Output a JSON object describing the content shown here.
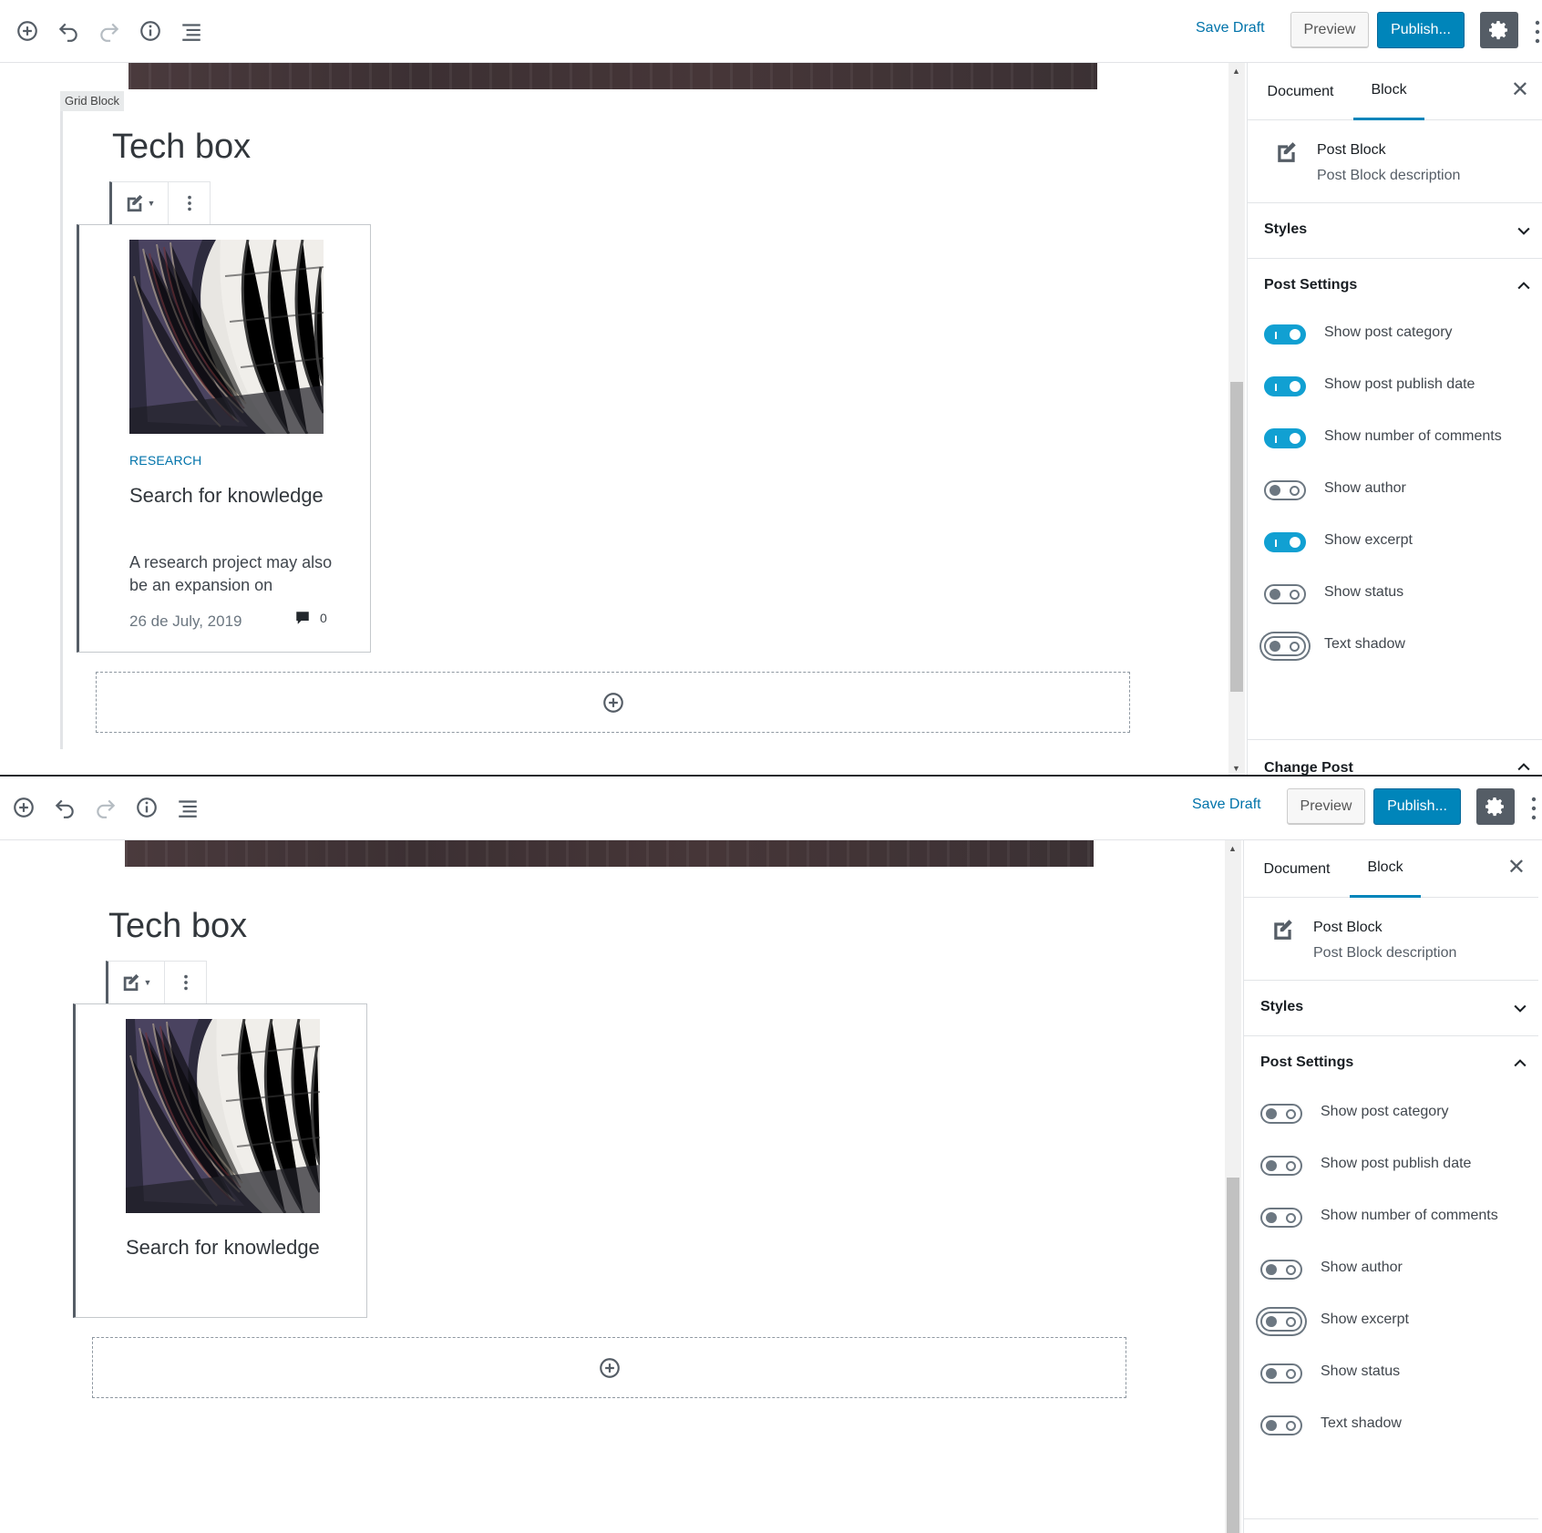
{
  "panels": [
    {
      "toolbar": {
        "save_draft": "Save Draft",
        "preview": "Preview",
        "publish": "Publish..."
      },
      "grid_label": "Grid Block",
      "heading": "Tech box",
      "post": {
        "category": "RESEARCH",
        "title": "Search for knowledge",
        "excerpt": "A research project may also be an expansion on",
        "date": "26 de July, 2019",
        "comments": "0"
      },
      "sidebar": {
        "tab_document": "Document",
        "tab_block": "Block",
        "block_title": "Post Block",
        "block_desc": "Post Block description",
        "styles": "Styles",
        "post_settings": "Post Settings",
        "change_post": "Change Post",
        "toggles": [
          {
            "label": "Show post category",
            "on": true
          },
          {
            "label": "Show post publish date",
            "on": true
          },
          {
            "label": "Show number of comments",
            "on": true
          },
          {
            "label": "Show author",
            "on": false
          },
          {
            "label": "Show excerpt",
            "on": true
          },
          {
            "label": "Show status",
            "on": false
          },
          {
            "label": "Text shadow",
            "on": false
          }
        ]
      }
    },
    {
      "toolbar": {
        "save_draft": "Save Draft",
        "preview": "Preview",
        "publish": "Publish..."
      },
      "heading": "Tech box",
      "post": {
        "title": "Search for knowledge"
      },
      "sidebar": {
        "tab_document": "Document",
        "tab_block": "Block",
        "block_title": "Post Block",
        "block_desc": "Post Block description",
        "styles": "Styles",
        "post_settings": "Post Settings",
        "toggles": [
          {
            "label": "Show post category",
            "on": false
          },
          {
            "label": "Show post publish date",
            "on": false
          },
          {
            "label": "Show number of comments",
            "on": false
          },
          {
            "label": "Show author",
            "on": false
          },
          {
            "label": "Show excerpt",
            "on": false
          },
          {
            "label": "Show status",
            "on": false
          },
          {
            "label": "Text shadow",
            "on": false
          }
        ]
      }
    }
  ],
  "colors": {
    "accent": "#0085ba",
    "toggle_on": "#11a0d2",
    "link": "#0073aa"
  }
}
